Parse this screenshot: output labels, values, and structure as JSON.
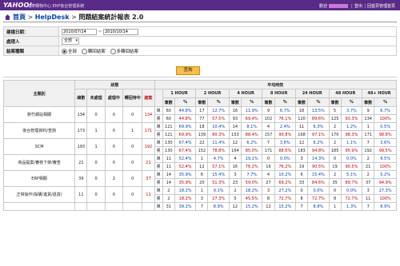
{
  "header": {
    "logo": "YAHOO!",
    "system": "奇摩購物中心 ERP後台管理系統",
    "user_prefix": "歡迎",
    "logout": "登出",
    "back": "回首頁管理首頁"
  },
  "breadcrumb": {
    "home": "首頁",
    "helpdesk": "HelpDesk",
    "current": "問題結案統計報表 2.0"
  },
  "form": {
    "date_label": "建檔日期：",
    "date_from": "2010/07/14",
    "date_sep": "~",
    "date_to": "2010/10/14",
    "handler_label": "處理人",
    "handler_value": "全部",
    "status_label": "結案種類",
    "status_options": [
      "全部",
      "轉回結案",
      "多轉回結案"
    ],
    "query": "查詢"
  },
  "table": {
    "group_status": "狀態",
    "group_avg": "平均時效",
    "main_category": "主類別",
    "status_cols": [
      "總數",
      "未處理",
      "處理中",
      "轉回待中",
      "結案"
    ],
    "time_cols": [
      "1 HOUR",
      "2 HOUR",
      "4 HOUR",
      "8 HOUR",
      "24 HOUR",
      "48 HOUR",
      "48+ HOUR"
    ],
    "sub_cols": [
      "筆數",
      "%"
    ],
    "row_labels": [
      "單",
      "累"
    ],
    "rows": [
      {
        "category": "新竹網站相關",
        "total": "134",
        "unproc": "0",
        "proc": "0",
        "pending": "0",
        "closed": "134",
        "single": [
          "60",
          "44.8%",
          "17",
          "12.7%",
          "16",
          "11.9%",
          "9",
          "6.7%",
          "18",
          "13.5%",
          "5",
          "3.7%",
          "9",
          "6.7%"
        ],
        "cumul": [
          "60",
          "44.8%",
          "77",
          "57.5%",
          "93",
          "69.4%",
          "102",
          "76.1%",
          "120",
          "89.6%",
          "125",
          "93.3%",
          "134",
          "100%"
        ]
      },
      {
        "category": "後台管理資料/查詢",
        "total": "173",
        "unproc": "1",
        "proc": "0",
        "pending": "1",
        "closed": "171",
        "single": [
          "121",
          "69.9%",
          "18",
          "10.4%",
          "14",
          "8.1%",
          "4",
          "2.4%",
          "11",
          "6.3%",
          "2",
          "1.2%",
          "1",
          "0.5%"
        ],
        "cumul": [
          "121",
          "69.9%",
          "139",
          "80.3%",
          "153",
          "88.4%",
          "157",
          "90.8%",
          "168",
          "97.1%",
          "170",
          "98.3%",
          "171",
          "98.8%"
        ]
      },
      {
        "category": "SCM",
        "total": "193",
        "unproc": "1",
        "proc": "0",
        "pending": "0",
        "closed": "192",
        "single": [
          "130",
          "67.4%",
          "22",
          "11.4%",
          "12",
          "6.2%",
          "7",
          "3.6%",
          "12",
          "6.2%",
          "2",
          "1.1%",
          "7",
          "3.6%"
        ],
        "cumul": [
          "130",
          "67.4%",
          "152",
          "78.8%",
          "164",
          "85.0%",
          "171",
          "88.6%",
          "183",
          "94.8%",
          "185",
          "95.9%",
          "192",
          "99.5%"
        ]
      },
      {
        "category": "商品提案/審核下架/審查",
        "total": "21",
        "unproc": "0",
        "proc": "0",
        "pending": "0",
        "closed": "21",
        "single": [
          "11",
          "52.4%",
          "1",
          "4.7%",
          "4",
          "19.1%",
          "0",
          "0.0%",
          "3",
          "14.3%",
          "0",
          "0.0%",
          "2",
          "9.5%"
        ],
        "cumul": [
          "11",
          "52.4%",
          "12",
          "57.1%",
          "16",
          "76.2%",
          "16",
          "76.2%",
          "19",
          "90.5%",
          "19",
          "90.5%",
          "21",
          "100%"
        ]
      },
      {
        "category": "ERP相關",
        "total": "39",
        "unproc": "0",
        "proc": "2",
        "pending": "0",
        "closed": "37",
        "single": [
          "14",
          "35.9%",
          "6",
          "15.4%",
          "3",
          "7.7%",
          "4",
          "10.2%",
          "6",
          "15.4%",
          "2",
          "5.1%",
          "2",
          "5.2%"
        ],
        "cumul": [
          "14",
          "35.9%",
          "20",
          "51.3%",
          "23",
          "59.0%",
          "27",
          "69.2%",
          "33",
          "84.6%",
          "35",
          "89.7%",
          "37",
          "94.9%"
        ]
      },
      {
        "category": "正常操作(採購/進貨/退貨)",
        "total": "11",
        "unproc": "0",
        "proc": "0",
        "pending": "0",
        "closed": "11",
        "single": [
          "2",
          "18.2%",
          "1",
          "9.1%",
          "2",
          "18.2%",
          "3",
          "27.2%",
          "0",
          "0.0%",
          "0",
          "0.0%",
          "3",
          "27.3%"
        ],
        "cumul": [
          "2",
          "18.2%",
          "3",
          "27.3%",
          "5",
          "45.5%",
          "8",
          "72.7%",
          "8",
          "72.7%",
          "8",
          "72.7%",
          "11",
          "100%"
        ]
      },
      {
        "category": "",
        "total": "",
        "unproc": "",
        "proc": "",
        "pending": "",
        "closed": "",
        "single": [
          "31",
          "39.2%",
          "7",
          "8.9%",
          "12",
          "15.2%",
          "12",
          "15.2%",
          "7",
          "8.8%",
          "1",
          "1.3%",
          "7",
          "8.9%"
        ],
        "cumul": []
      }
    ]
  }
}
